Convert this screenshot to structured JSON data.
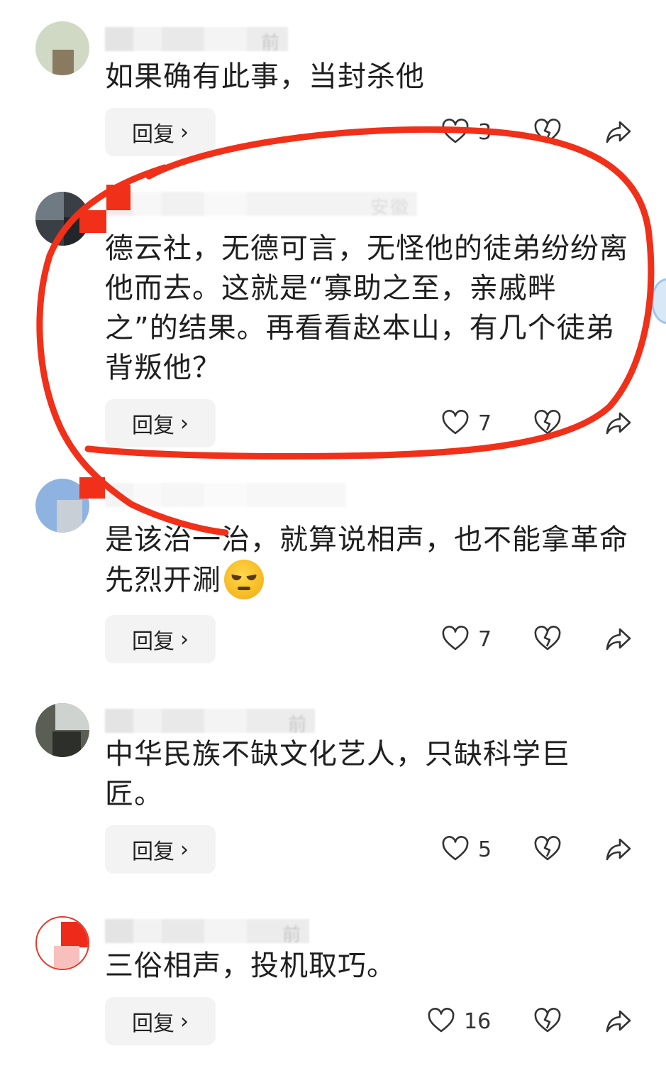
{
  "comments": [
    {
      "meta": "前",
      "text": "如果确有此事，当封杀他",
      "reply_label": "回复",
      "likes": "3"
    },
    {
      "meta": "安徽",
      "text": "德云社，无德可言，无怪他的徒弟纷纷离他而去。这就是“寡助之至，亲戚畔之”的结果。再看看赵本山，有几个徒弟背叛他？",
      "reply_label": "回复",
      "likes": "7"
    },
    {
      "meta": "",
      "text": "是该治一治，就算说相声，也不能拿革命先烈开涮",
      "reply_label": "回复",
      "likes": "7"
    },
    {
      "meta": "前",
      "text": "中华民族不缺文化艺人，只缺科学巨匠。",
      "reply_label": "回复",
      "likes": "5"
    },
    {
      "meta": "前",
      "text": "三俗相声，投机取巧。",
      "reply_label": "回复",
      "likes": "16"
    }
  ],
  "icons": {
    "like": "heart-outline-icon",
    "dislike": "broken-heart-icon",
    "share": "share-arrow-icon",
    "reply_chevron": "chevron-right-icon",
    "emoji": "pouting-face-emoji"
  },
  "colors": {
    "annotation_red": "#f03018",
    "reply_bg": "#f3f3f3"
  }
}
